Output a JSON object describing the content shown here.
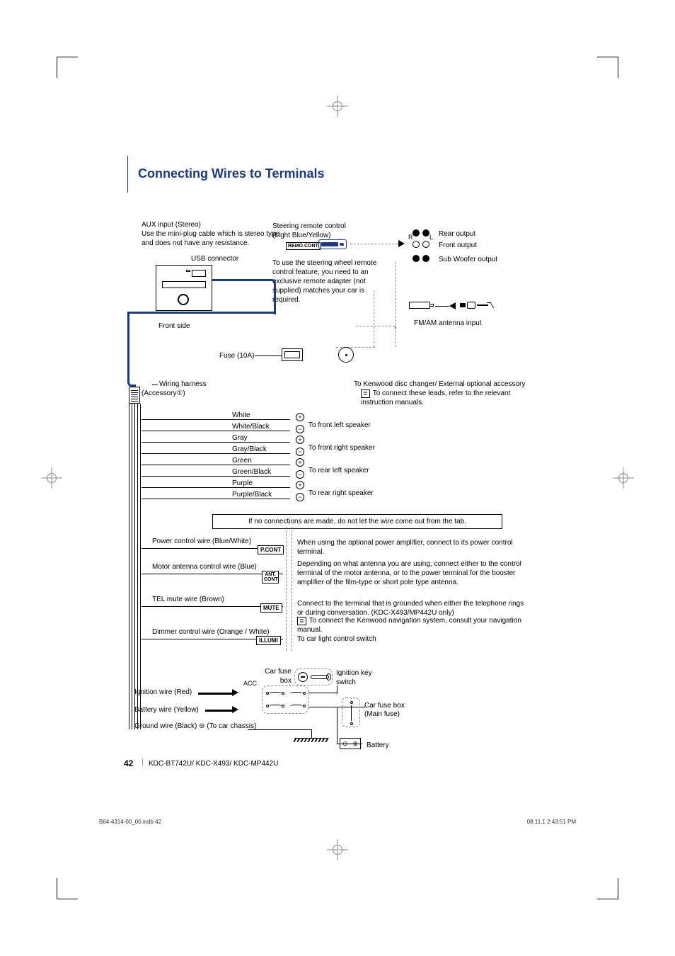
{
  "page": {
    "title": "Connecting Wires to Terminals",
    "number": "42",
    "models": "KDC-BT742U/ KDC-X493/ KDC-MP442U",
    "indb": "B64-4314-00_00.indb   42",
    "timestamp": "08.11.1   2:43:51 PM"
  },
  "head_unit": {
    "aux_title": "AUX input (Stereo)",
    "aux_desc": "Use the mini-plug cable which is stereo type and does not have any resistance.",
    "usb_label": "USB connector",
    "front_side": "Front side",
    "fuse_label": "Fuse (10A)"
  },
  "remote": {
    "title": "Steering remote control",
    "subtitle": "(Light Blue/Yellow)",
    "tag": "REMO.CONT",
    "note": "To use the steering wheel remote control feature, you need to an exclusive remote adapter (not supplied) matches your car is required."
  },
  "rca": {
    "R": "R",
    "L": "L",
    "rear": "Rear output",
    "front": "Front output",
    "sub": "Sub Woofer output"
  },
  "antenna": {
    "label": "FM/AM antenna input"
  },
  "changer": {
    "line1": "To Kenwood disc changer/ External optional accessory",
    "line2": "To connect these leads, refer to the relevant instruction manuals."
  },
  "harness": {
    "label": "Wiring harness",
    "accessory": "(Accessory①)"
  },
  "speakers": {
    "white": "White",
    "white_black": "White/Black",
    "gray": "Gray",
    "gray_black": "Gray/Black",
    "green": "Green",
    "green_black": "Green/Black",
    "purple": "Purple",
    "purple_black": "Purple/Black",
    "front_left": "To front left speaker",
    "front_right": "To front right speaker",
    "rear_left": "To rear left speaker",
    "rear_right": "To rear right speaker"
  },
  "tab_note": "If no connections are made, do not let the wire come out from the tab.",
  "control_wires": {
    "pcont_label": "Power control wire (Blue/White)",
    "pcont_tag": "P.CONT",
    "pcont_desc": "When using the optional power amplifier, connect to its power control terminal.",
    "ant_label": "Motor antenna control wire (Blue)",
    "ant_tag_1": "ANT.",
    "ant_tag_2": "CONT",
    "ant_desc": "Depending on what antenna you are using, connect either to the control terminal of the motor antenna, or to the power terminal for the booster amplifier of the film-type or short pole type antenna.",
    "mute_label": "TEL mute wire (Brown)",
    "mute_tag": "MUTE",
    "mute_desc1": "Connect to the terminal that is grounded when either the telephone rings or during conversation. (KDC-X493/MP442U only)",
    "mute_desc2": "To connect the Kenwood navigation system, consult your navigation manual.",
    "dimmer_label": "Dimmer control wire (Orange / White)",
    "dimmer_tag": "ILLUMI",
    "dimmer_desc": "To car light control switch"
  },
  "power": {
    "car_fuse_box": "Car fuse box",
    "acc": "ACC",
    "ignition_key": "Ignition key switch",
    "ignition_wire": "Ignition wire (Red)",
    "battery_wire": "Battery wire (Yellow)",
    "ground_wire": "Ground wire (Black) ⊖ (To car chassis)",
    "car_fuse_main": "Car fuse box",
    "main_fuse": "(Main fuse)",
    "battery": "Battery"
  }
}
